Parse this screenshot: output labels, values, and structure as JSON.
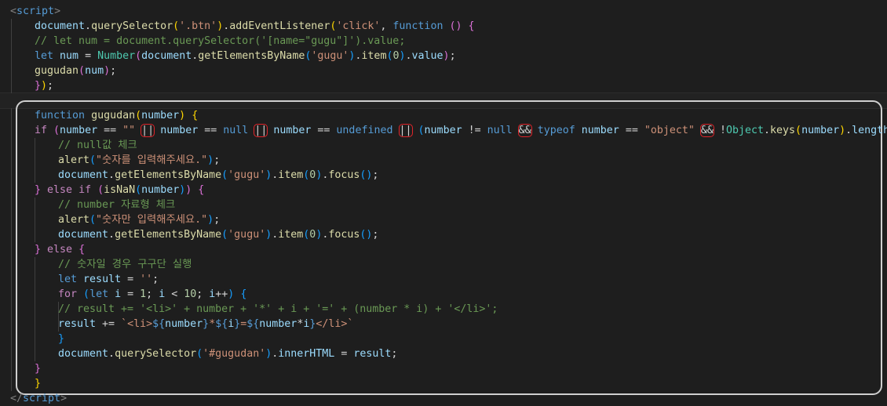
{
  "editor": {
    "language": "javascript",
    "lines": [
      {
        "tokens": [
          [
            "<",
            "tag"
          ],
          [
            "script",
            "tagname"
          ],
          [
            ">",
            "tag"
          ]
        ]
      },
      {
        "tokens": [
          [
            "document",
            "var"
          ],
          [
            ".",
            "op"
          ],
          [
            "querySelector",
            "fn"
          ],
          [
            "(",
            "br1"
          ],
          [
            "'.btn'",
            "str"
          ],
          [
            ")",
            "br1"
          ],
          [
            ".",
            "op"
          ],
          [
            "addEventListener",
            "fn"
          ],
          [
            "(",
            "br1"
          ],
          [
            "'click'",
            "str"
          ],
          [
            ", ",
            "op"
          ],
          [
            "function",
            "kw"
          ],
          [
            " ",
            "op"
          ],
          [
            "()",
            "br2"
          ],
          [
            " ",
            "op"
          ],
          [
            "{",
            "br2"
          ]
        ]
      },
      {
        "tokens": [
          [
            "// let num = document.querySelector('[name=\"gugu\"]').value;",
            "cmt"
          ]
        ]
      },
      {
        "tokens": [
          [
            "let",
            "kw"
          ],
          [
            " ",
            "op"
          ],
          [
            "num",
            "var"
          ],
          [
            " = ",
            "op"
          ],
          [
            "Number",
            "cls"
          ],
          [
            "(",
            "br2"
          ],
          [
            "document",
            "var"
          ],
          [
            ".",
            "op"
          ],
          [
            "getElementsByName",
            "fn"
          ],
          [
            "(",
            "br3"
          ],
          [
            "'gugu'",
            "str"
          ],
          [
            ")",
            "br3"
          ],
          [
            ".",
            "op"
          ],
          [
            "item",
            "fn"
          ],
          [
            "(",
            "br3"
          ],
          [
            "0",
            "num"
          ],
          [
            ")",
            "br3"
          ],
          [
            ".",
            "op"
          ],
          [
            "value",
            "var"
          ],
          [
            ")",
            "br2"
          ],
          [
            ";",
            "op"
          ]
        ]
      },
      {
        "tokens": [
          [
            "gugudan",
            "fn"
          ],
          [
            "(",
            "br2"
          ],
          [
            "num",
            "var"
          ],
          [
            ")",
            "br2"
          ],
          [
            ";",
            "op"
          ]
        ]
      },
      {
        "tokens": [
          [
            "}",
            "br2"
          ],
          [
            ")",
            "br1"
          ],
          [
            ";",
            "op"
          ]
        ]
      },
      {
        "tokens": []
      },
      {
        "tokens": [
          [
            "function",
            "kw"
          ],
          [
            " ",
            "op"
          ],
          [
            "gugudan",
            "fn"
          ],
          [
            "(",
            "br1"
          ],
          [
            "number",
            "var"
          ],
          [
            ")",
            "br1"
          ],
          [
            " ",
            "op"
          ],
          [
            "{",
            "br1"
          ]
        ]
      },
      {
        "tokens": [
          [
            "if",
            "ctl"
          ],
          [
            " ",
            "op"
          ],
          [
            "(",
            "br2"
          ],
          [
            "number",
            "var"
          ],
          [
            " == ",
            "op"
          ],
          [
            "\"\"",
            "str"
          ],
          [
            " ",
            "op"
          ],
          [
            "||",
            "op",
            "box"
          ],
          [
            " ",
            "op"
          ],
          [
            "number",
            "var"
          ],
          [
            " == ",
            "op"
          ],
          [
            "null",
            "kw"
          ],
          [
            " ",
            "op"
          ],
          [
            "||",
            "op",
            "box"
          ],
          [
            " ",
            "op"
          ],
          [
            "number",
            "var"
          ],
          [
            " == ",
            "op"
          ],
          [
            "undefined",
            "kw"
          ],
          [
            " ",
            "op"
          ],
          [
            "||",
            "op",
            "box"
          ],
          [
            " ",
            "op"
          ],
          [
            "(",
            "br3"
          ],
          [
            "number",
            "var"
          ],
          [
            " != ",
            "op"
          ],
          [
            "null",
            "kw"
          ],
          [
            " ",
            "op"
          ],
          [
            "&&",
            "op",
            "box"
          ],
          [
            " ",
            "op"
          ],
          [
            "typeof",
            "kw"
          ],
          [
            " ",
            "op"
          ],
          [
            "number",
            "var"
          ],
          [
            " == ",
            "op"
          ],
          [
            "\"object\"",
            "str"
          ],
          [
            " ",
            "op"
          ],
          [
            "&&",
            "op",
            "box"
          ],
          [
            " ",
            "op"
          ],
          [
            "!",
            "op"
          ],
          [
            "Object",
            "cls"
          ],
          [
            ".",
            "op"
          ],
          [
            "keys",
            "fn"
          ],
          [
            "(",
            "br1"
          ],
          [
            "number",
            "var"
          ],
          [
            ")",
            "br1"
          ],
          [
            ".",
            "op"
          ],
          [
            "length",
            "var"
          ],
          [
            ")",
            "br3"
          ],
          [
            ")",
            "br2"
          ],
          [
            "{",
            "br2"
          ]
        ]
      },
      {
        "tokens": [
          [
            "// null값 체크",
            "cmt"
          ]
        ]
      },
      {
        "tokens": [
          [
            "alert",
            "fn"
          ],
          [
            "(",
            "br3"
          ],
          [
            "\"숫자를 입력해주세요.\"",
            "str"
          ],
          [
            ")",
            "br3"
          ],
          [
            ";",
            "op"
          ]
        ]
      },
      {
        "tokens": [
          [
            "document",
            "var"
          ],
          [
            ".",
            "op"
          ],
          [
            "getElementsByName",
            "fn"
          ],
          [
            "(",
            "br3"
          ],
          [
            "'gugu'",
            "str"
          ],
          [
            ")",
            "br3"
          ],
          [
            ".",
            "op"
          ],
          [
            "item",
            "fn"
          ],
          [
            "(",
            "br3"
          ],
          [
            "0",
            "num"
          ],
          [
            ")",
            "br3"
          ],
          [
            ".",
            "op"
          ],
          [
            "focus",
            "fn"
          ],
          [
            "()",
            "br3"
          ],
          [
            ";",
            "op"
          ]
        ]
      },
      {
        "tokens": [
          [
            "}",
            "br2"
          ],
          [
            " ",
            "op"
          ],
          [
            "else",
            "ctl"
          ],
          [
            " ",
            "op"
          ],
          [
            "if",
            "ctl"
          ],
          [
            " ",
            "op"
          ],
          [
            "(",
            "br2"
          ],
          [
            "isNaN",
            "fn"
          ],
          [
            "(",
            "br3"
          ],
          [
            "number",
            "var"
          ],
          [
            ")",
            "br3"
          ],
          [
            ")",
            "br2"
          ],
          [
            " ",
            "op"
          ],
          [
            "{",
            "br2"
          ]
        ]
      },
      {
        "tokens": [
          [
            "// number 자료형 체크",
            "cmt"
          ]
        ]
      },
      {
        "tokens": [
          [
            "alert",
            "fn"
          ],
          [
            "(",
            "br3"
          ],
          [
            "\"숫자만 입력해주세요.\"",
            "str"
          ],
          [
            ")",
            "br3"
          ],
          [
            ";",
            "op"
          ]
        ]
      },
      {
        "tokens": [
          [
            "document",
            "var"
          ],
          [
            ".",
            "op"
          ],
          [
            "getElementsByName",
            "fn"
          ],
          [
            "(",
            "br3"
          ],
          [
            "'gugu'",
            "str"
          ],
          [
            ")",
            "br3"
          ],
          [
            ".",
            "op"
          ],
          [
            "item",
            "fn"
          ],
          [
            "(",
            "br3"
          ],
          [
            "0",
            "num"
          ],
          [
            ")",
            "br3"
          ],
          [
            ".",
            "op"
          ],
          [
            "focus",
            "fn"
          ],
          [
            "()",
            "br3"
          ],
          [
            ";",
            "op"
          ]
        ]
      },
      {
        "tokens": [
          [
            "}",
            "br2"
          ],
          [
            " ",
            "op"
          ],
          [
            "else",
            "ctl"
          ],
          [
            " ",
            "op"
          ],
          [
            "{",
            "br2"
          ]
        ]
      },
      {
        "tokens": [
          [
            "// 숫자일 경우 구구단 실행",
            "cmt"
          ]
        ]
      },
      {
        "tokens": [
          [
            "let",
            "kw"
          ],
          [
            " ",
            "op"
          ],
          [
            "result",
            "var"
          ],
          [
            " = ",
            "op"
          ],
          [
            "''",
            "str"
          ],
          [
            ";",
            "op"
          ]
        ]
      },
      {
        "tokens": [
          [
            "for",
            "ctl"
          ],
          [
            " ",
            "op"
          ],
          [
            "(",
            "br3"
          ],
          [
            "let",
            "kw"
          ],
          [
            " ",
            "op"
          ],
          [
            "i",
            "var"
          ],
          [
            " = ",
            "op"
          ],
          [
            "1",
            "num"
          ],
          [
            "; ",
            "op"
          ],
          [
            "i",
            "var"
          ],
          [
            " < ",
            "op"
          ],
          [
            "10",
            "num"
          ],
          [
            "; ",
            "op"
          ],
          [
            "i",
            "var"
          ],
          [
            "++",
            "op"
          ],
          [
            ")",
            "br3"
          ],
          [
            " ",
            "op"
          ],
          [
            "{",
            "br3"
          ]
        ]
      },
      {
        "tokens": [
          [
            "// result += '<li>' + number + '*' + i + '=' + (number * i) + '</li>';",
            "cmt"
          ]
        ]
      },
      {
        "tokens": [
          [
            "result",
            "var"
          ],
          [
            " += ",
            "op"
          ],
          [
            "`<li>",
            "str"
          ],
          [
            "${",
            "kw"
          ],
          [
            "number",
            "var"
          ],
          [
            "}",
            "kw"
          ],
          [
            "*",
            "str"
          ],
          [
            "${",
            "kw"
          ],
          [
            "i",
            "var"
          ],
          [
            "}",
            "kw"
          ],
          [
            "=",
            "str"
          ],
          [
            "${",
            "kw"
          ],
          [
            "number",
            "var"
          ],
          [
            "*",
            "op"
          ],
          [
            "i",
            "var"
          ],
          [
            "}",
            "kw"
          ],
          [
            "</li>`",
            "str"
          ]
        ]
      },
      {
        "tokens": [
          [
            "}",
            "br3"
          ]
        ]
      },
      {
        "tokens": [
          [
            "document",
            "var"
          ],
          [
            ".",
            "op"
          ],
          [
            "querySelector",
            "fn"
          ],
          [
            "(",
            "br3"
          ],
          [
            "'#gugudan'",
            "str"
          ],
          [
            ")",
            "br3"
          ],
          [
            ".",
            "op"
          ],
          [
            "innerHTML",
            "var"
          ],
          [
            " = ",
            "op"
          ],
          [
            "result",
            "var"
          ],
          [
            ";",
            "op"
          ]
        ]
      },
      {
        "tokens": [
          [
            "}",
            "br2"
          ]
        ]
      },
      {
        "tokens": [
          [
            "}",
            "br1"
          ]
        ]
      },
      {
        "tokens": [
          [
            "</",
            "tag"
          ],
          [
            "script",
            "tagname"
          ],
          [
            ">",
            "tag"
          ]
        ]
      }
    ]
  }
}
